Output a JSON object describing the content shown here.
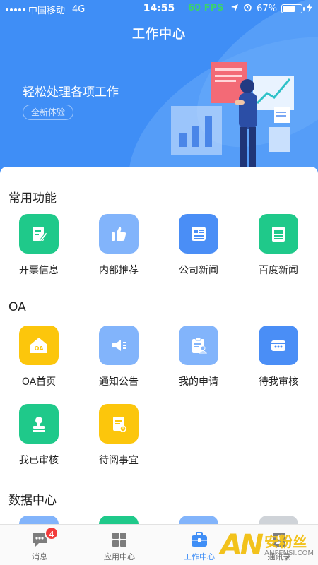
{
  "status_bar": {
    "carrier": "中国移动",
    "network": "4G",
    "time": "14:55",
    "fps": "60 FPS",
    "battery_percent": "67%",
    "battery_level": 0.67
  },
  "header": {
    "title": "工作中心",
    "slogan": "轻松处理各项工作",
    "badge": "全新体验"
  },
  "sections": {
    "common": {
      "title": "常用功能",
      "items": [
        {
          "label": "开票信息",
          "icon": "invoice-edit-icon",
          "color": "#1fc98a"
        },
        {
          "label": "内部推荐",
          "icon": "thumbs-up-icon",
          "color": "#82b4fb"
        },
        {
          "label": "公司新闻",
          "icon": "news-icon",
          "color": "#4a8ef6"
        },
        {
          "label": "百度新闻",
          "icon": "newspaper-icon",
          "color": "#1fc98a"
        }
      ]
    },
    "oa": {
      "title": "OA",
      "items": [
        {
          "label": "OA首页",
          "icon": "oa-home-icon",
          "color": "#fcc60c"
        },
        {
          "label": "通知公告",
          "icon": "megaphone-icon",
          "color": "#82b4fb"
        },
        {
          "label": "我的申请",
          "icon": "clipboard-person-icon",
          "color": "#82b4fb"
        },
        {
          "label": "待我审核",
          "icon": "card-dots-icon",
          "color": "#4a8ef6"
        },
        {
          "label": "我已审核",
          "icon": "stamp-icon",
          "color": "#1fc98a"
        },
        {
          "label": "待阅事宜",
          "icon": "document-clock-icon",
          "color": "#fcc60c"
        }
      ]
    },
    "data": {
      "title": "数据中心"
    }
  },
  "tabbar": {
    "tabs": [
      {
        "label": "消息",
        "icon": "message-icon",
        "badge": "4"
      },
      {
        "label": "应用中心",
        "icon": "apps-grid-icon"
      },
      {
        "label": "工作中心",
        "icon": "briefcase-icon",
        "active": true
      },
      {
        "label": "通讯录",
        "icon": "contacts-icon"
      }
    ]
  },
  "watermark": {
    "logo": "AN",
    "name": "安粉丝",
    "url": "ANFENSI.COM"
  },
  "colors": {
    "primary": "#3f8ef6",
    "badge_red": "#f23b3b",
    "fps_green": "#3bd16f"
  }
}
